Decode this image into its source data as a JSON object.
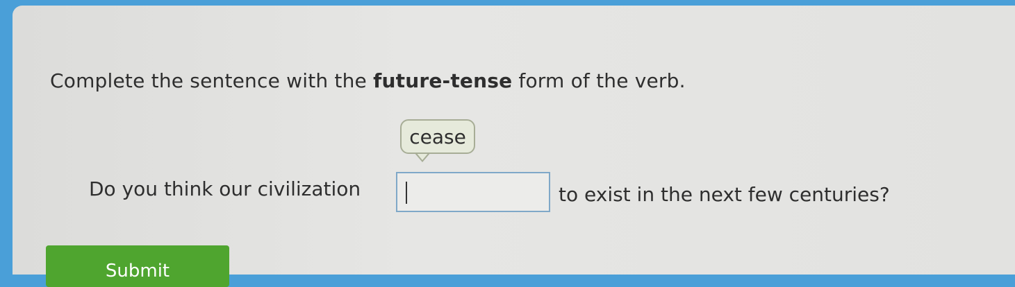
{
  "question": {
    "instruction_pre": "Complete the sentence with the ",
    "instruction_bold": "future-tense",
    "instruction_post": " form of the verb.",
    "verb_hint": "cease",
    "sentence_before": "Do you think our civilization",
    "answer_value": "",
    "sentence_after": "to exist in the next few centuries?"
  },
  "actions": {
    "submit_label": "Submit"
  },
  "colors": {
    "background": "#4a9fd8",
    "panel": "#e4e4e2",
    "submit": "#4fa52f",
    "input_border": "#7fa8c8"
  }
}
